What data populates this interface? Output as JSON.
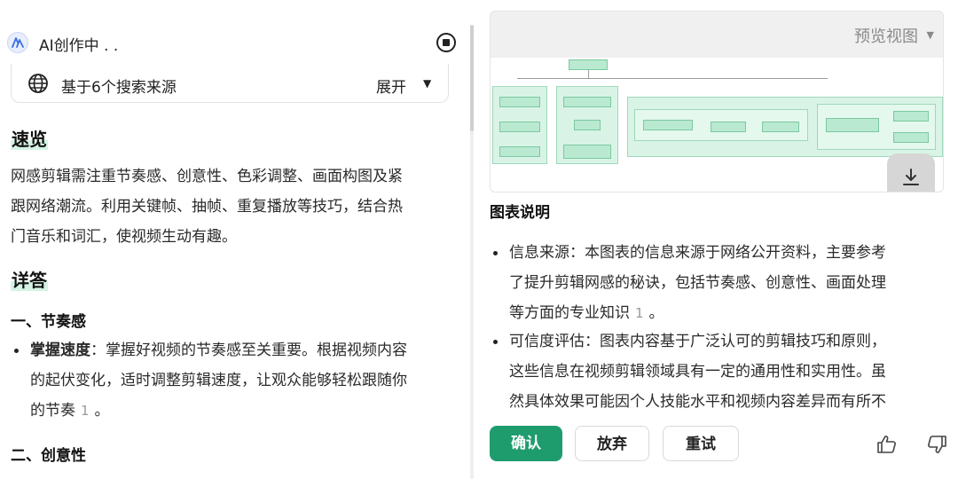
{
  "left": {
    "status_text": "AI创作中 . .",
    "sources_label": "基于6个搜索来源",
    "expand_label": "展开",
    "overview_heading": "速览",
    "overview_lines": [
      "网感剪辑需注重节奏感、创意性、色彩调整、画面构图及紧",
      "跟网络潮流。利用关键帧、抽帧、重复播放等技巧，结合热",
      "门音乐和词汇，使视频生动有趣。"
    ],
    "details_heading": "详答",
    "section1_title": "一、节奏感",
    "bullet1": {
      "bold": "掌握速度",
      "lines": [
        "：掌握好视频的节奏感至关重要。根据视频内容",
        "的起伏变化，适时调整剪辑速度，让观众能够轻松跟随你",
        "的节奏"
      ],
      "cite": "1",
      "end": "。"
    },
    "section2_title": "二、创意性"
  },
  "right": {
    "preview_label": "预览视图",
    "chart_title": "图表说明",
    "bullet1_lines": [
      "信息来源：本图表的信息来源于网络公开资料，主要参考",
      "了提升剪辑网感的秘诀，包括节奏感、创意性、画面处理",
      "等方面的专业知识"
    ],
    "bullet1_cite": "1",
    "bullet1_end": "。",
    "bullet2_lines": [
      "可信度评估：图表内容基于广泛认可的剪辑技巧和原则，",
      "这些信息在视频剪辑领域具有一定的通用性和实用性。虽",
      "然具体效果可能因个人技能水平和视频内容差异而有所不"
    ],
    "confirm_label": "确认",
    "discard_label": "放弃",
    "retry_label": "重试"
  },
  "colors": {
    "accent": "#1e9c6d",
    "highlight": "#d5f3e4",
    "diagram_fill": "#d9f4e6"
  },
  "icons": [
    "ai-logo-icon",
    "stop-icon",
    "globe-icon",
    "chevron-down-icon",
    "download-icon",
    "thumbs-up-icon",
    "thumbs-down-icon"
  ]
}
